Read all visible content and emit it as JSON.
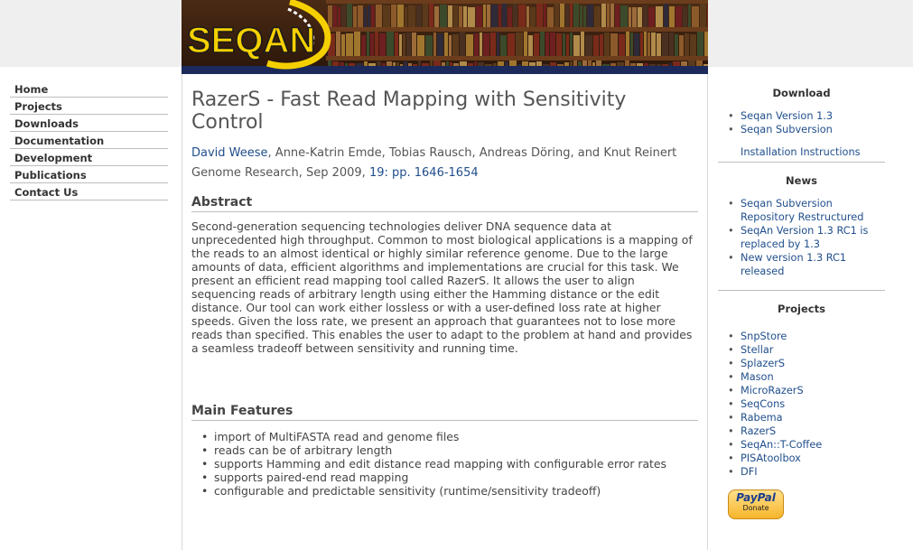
{
  "banner": {
    "logo_text": "SEQAN"
  },
  "nav": {
    "items": [
      {
        "label": "Home"
      },
      {
        "label": "Projects"
      },
      {
        "label": "Downloads"
      },
      {
        "label": "Documentation"
      },
      {
        "label": "Development"
      },
      {
        "label": "Publications"
      },
      {
        "label": "Contact Us"
      }
    ]
  },
  "article": {
    "title": "RazerS - Fast Read Mapping with Sensitivity Control",
    "first_author": "David Weese",
    "other_authors": ", Anne-Katrin Emde, Tobias Rausch, Andreas Döring, and Knut Reinert",
    "journal": "Genome Research, Sep 2009, ",
    "pages_link": "19: pp. 1646-1654",
    "abstract_heading": "Abstract",
    "abstract": "Second-generation sequencing technologies deliver DNA sequence data at unprecedented high throughput. Common to most biological applications is a mapping of the reads to an almost identical or highly similar reference genome. Due to the large amounts of data, efficient algorithms and implementations are crucial for this task. We present an efficient read mapping tool called RazerS. It allows the user to align sequencing reads of arbitrary length using either the Hamming distance or the edit distance. Our tool can work either lossless or with a user-defined loss rate at higher speeds. Given the loss rate, we present an approach that guarantees not to lose more reads than specified. This enables the user to adapt to the problem at hand and provides a seamless tradeoff between sensitivity and running time.",
    "features_heading": "Main Features",
    "features": [
      "import of MultiFASTA read and genome files",
      "reads can be of arbitrary length",
      "supports Hamming and edit distance read mapping with configurable error rates",
      "supports paired-end read mapping",
      "configurable and predictable sensitivity (runtime/sensitivity tradeoff)"
    ]
  },
  "sidebar": {
    "download_title": "Download",
    "download_items": [
      "Seqan Version 1.3",
      "Seqan Subversion"
    ],
    "install_link": "Installation Instructions",
    "news_title": "News",
    "news_items": [
      "Seqan Subversion Repository Restructured",
      "SeqAn Version 1.3 RC1 is replaced by 1.3",
      "New version 1.3 RC1 released"
    ],
    "projects_title": "Projects",
    "projects": [
      "SnpStore",
      "Stellar",
      "SplazerS",
      "Mason",
      "MicroRazerS",
      "SeqCons",
      "Rabema",
      "RazerS",
      "SeqAn::T-Coffee",
      "PISAtoolbox",
      "DFI"
    ],
    "paypal_logo": "PayPal",
    "paypal_donate": "Donate"
  },
  "colors": {
    "link": "#1f4e8c",
    "text": "#444444",
    "logo_yellow": "#f5d000"
  }
}
